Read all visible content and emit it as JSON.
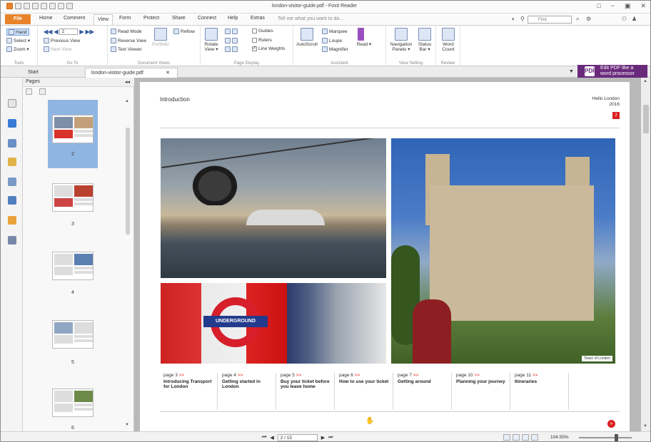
{
  "window": {
    "title": "london-visitor-guide.pdf - Foxit Reader",
    "controls": [
      "□",
      "−",
      "▣",
      "✕"
    ]
  },
  "menu": {
    "tabs": [
      "File",
      "Home",
      "Comment",
      "View",
      "Form",
      "Protect",
      "Share",
      "Connect",
      "Help",
      "Extras"
    ],
    "active": "View",
    "tell_me": "Tell me what you want to do...",
    "find_placeholder": "Find"
  },
  "ribbon": {
    "tools": {
      "hand": "Hand",
      "select": "Select ▾",
      "zoom": "Zoom ▾",
      "label": "Tools"
    },
    "goto": {
      "page_value": "2",
      "previous_view": "Previous View",
      "next_view": "Next View",
      "label": "Go To"
    },
    "document_views": {
      "read_mode": "Read Mode",
      "reverse_view": "Reverse View",
      "text_viewer": "Text Viewer",
      "portfolio": "Portfolio",
      "reflow": "Reflow",
      "label": "Document Views"
    },
    "page_display": {
      "rotate_view": "Rotate View ▾",
      "guides": "Guides",
      "rulers": "Rulers",
      "line_weights": "Line Weights",
      "label": "Page Display"
    },
    "assistant": {
      "autoscroll": "AutoScroll",
      "marquee": "Marquee",
      "loupe": "Loupe",
      "magnifier": "Magnifier",
      "read": "Read ▾",
      "label": "Assistant"
    },
    "view_setting": {
      "navigation_panels": "Navigation Panels ▾",
      "status_bar": "Status Bar ▾",
      "label": "View Setting"
    },
    "review": {
      "word_count": "Word Count",
      "label": "Review"
    }
  },
  "doc_tabs": [
    {
      "label": "Start"
    },
    {
      "label": "london-visitor-guide.pdf",
      "close": "✕"
    }
  ],
  "promo": {
    "mark": "PDF",
    "text": "Edit PDF like a word processor"
  },
  "pages_panel": {
    "title": "Pages",
    "collapse": "◂◂",
    "thumbnails": [
      {
        "number": "2",
        "selected": true
      },
      {
        "number": "3"
      },
      {
        "number": "4"
      },
      {
        "number": "5"
      },
      {
        "number": "6"
      }
    ]
  },
  "document": {
    "heading": "Introduction",
    "corner_line1": "Hello London",
    "corner_line2": "2016",
    "corner_num": "2",
    "tube_sign": "UNDERGROUND",
    "photo_caption": "Tower of London",
    "page_links": [
      {
        "page": "page 3",
        "arrow": ">>",
        "title": "Introducing Transport for London"
      },
      {
        "page": "page 4",
        "arrow": ">>",
        "title": "Getting started in London"
      },
      {
        "page": "page 5",
        "arrow": ">>",
        "title": "Buy your ticket before you leave home"
      },
      {
        "page": "page 6",
        "arrow": ">>",
        "title": "How to use your ticket"
      },
      {
        "page": "page 7",
        "arrow": ">>",
        "title": "Getting around"
      },
      {
        "page": "page 10",
        "arrow": ">>",
        "title": "Planning your journey"
      },
      {
        "page": "page 11",
        "arrow": ">>",
        "title": "Itineraries"
      }
    ],
    "bottom_icon_text": "✋",
    "bottom_circle": "»"
  },
  "status": {
    "page_indicator": "2 / 15",
    "zoom": "104.55%",
    "first": "⏮",
    "prev": "◀",
    "next": "▶",
    "last": "⏭"
  },
  "colors": {
    "file_tab": "#e8832a",
    "selected_thumb": "#8fb6e3",
    "promo": "#6a2a7c",
    "accent_red": "#d9201f"
  }
}
